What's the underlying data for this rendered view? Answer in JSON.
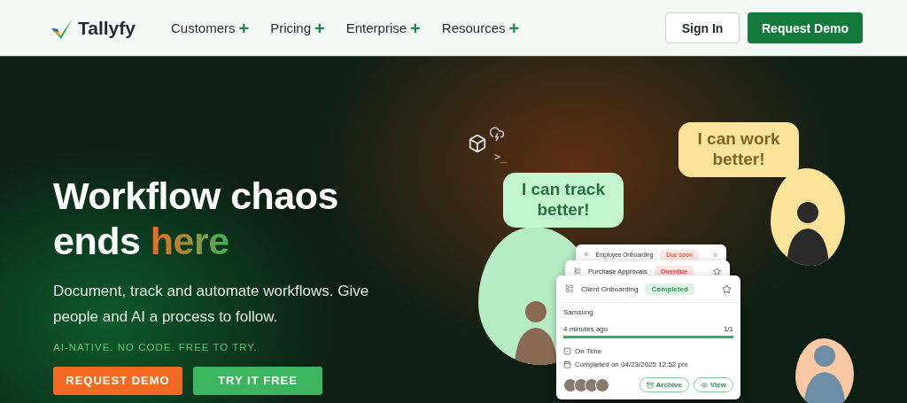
{
  "nav": {
    "brand": "Tallyfy",
    "menu": [
      {
        "label": "Customers",
        "expand": "+"
      },
      {
        "label": "Pricing",
        "expand": "+"
      },
      {
        "label": "Enterprise",
        "expand": "+"
      },
      {
        "label": "Resources",
        "expand": "+"
      }
    ],
    "sign_in": "Sign In",
    "request_demo": "Request Demo"
  },
  "hero": {
    "headline": "Workflow chaos ends",
    "headline_accent": "here",
    "subtitle": "Document, track and automate workflows. Give people and AI a process to follow.",
    "tagline": "AI-NATIVE. NO CODE. FREE TO TRY.",
    "buttons": [
      {
        "label": "REQUEST DEMO",
        "kind": "primary"
      },
      {
        "label": "TRY IT FREE",
        "kind": "secondary"
      }
    ]
  },
  "illustration": {
    "bubbles": [
      {
        "text": "I can track better!",
        "color": "#c3f5cf"
      },
      {
        "text": "I can work better!",
        "color": "#fbe49a"
      }
    ],
    "terminal_prompt": ">_",
    "cards": [
      {
        "title": "Employee Onboarding",
        "status": "Due soon",
        "color": "#e5533d"
      },
      {
        "title": "Purchase Approvals",
        "status": "Overdue",
        "color": "#e53935"
      },
      {
        "title": "Client Onboarding",
        "status": "Completed",
        "color": "#2e9b55",
        "company": "Samsung",
        "time": "4 minutes ago",
        "count": "1/1",
        "level": 1,
        "on_time": "On Time",
        "completed_on": "Completed on 04/23/2025 12:52 pm",
        "actions": [
          "Archive",
          "View"
        ]
      }
    ]
  }
}
